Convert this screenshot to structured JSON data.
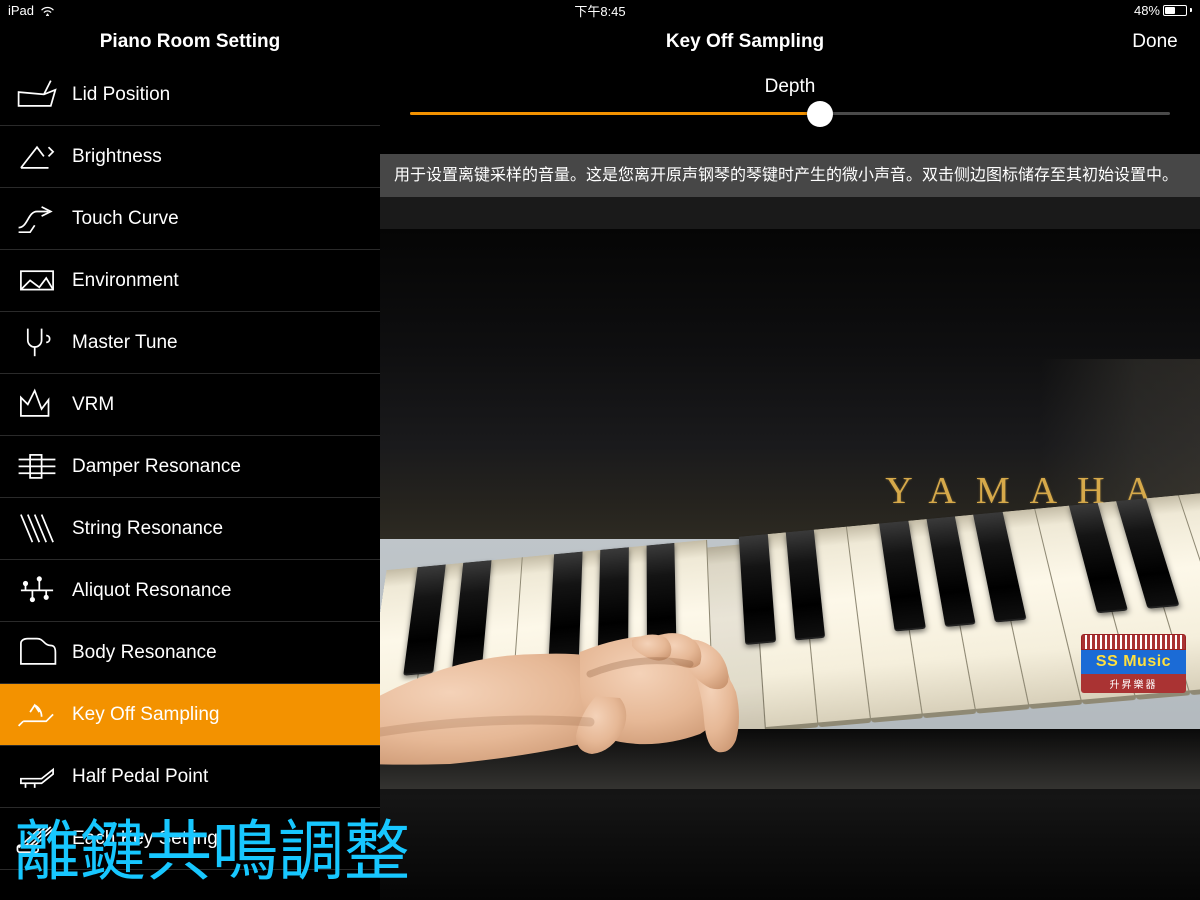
{
  "status": {
    "device": "iPad",
    "time": "下午8:45",
    "battery_pct": "48%",
    "battery_fill_pct": 48
  },
  "header": {
    "sidebar_title": "Piano Room Setting",
    "detail_title": "Key Off Sampling",
    "done_label": "Done"
  },
  "sidebar": {
    "items": [
      {
        "label": "Lid Position",
        "icon": "piano-lid-icon"
      },
      {
        "label": "Brightness",
        "icon": "brightness-icon"
      },
      {
        "label": "Touch Curve",
        "icon": "touch-curve-icon"
      },
      {
        "label": "Environment",
        "icon": "environment-icon"
      },
      {
        "label": "Master Tune",
        "icon": "tuning-fork-icon"
      },
      {
        "label": "VRM",
        "icon": "vrm-icon"
      },
      {
        "label": "Damper Resonance",
        "icon": "damper-icon"
      },
      {
        "label": "String Resonance",
        "icon": "strings-icon"
      },
      {
        "label": "Aliquot Resonance",
        "icon": "aliquot-icon"
      },
      {
        "label": "Body Resonance",
        "icon": "piano-body-icon"
      },
      {
        "label": "Key Off Sampling",
        "icon": "key-off-icon"
      },
      {
        "label": "Half Pedal Point",
        "icon": "pedal-icon"
      },
      {
        "label": "Each Key Setting",
        "icon": "keys-icon"
      }
    ],
    "selected_index": 10
  },
  "slider": {
    "label": "Depth",
    "value_pct": 54
  },
  "description": "用于设置离键采样的音量。这是您离开原声钢琴的琴键时产生的微小声音。双击侧边图标储存至其初始设置中。",
  "brand": "YAMAHA",
  "badge": {
    "title": "SS Music",
    "subtitle": "升昇樂器"
  },
  "caption": "離鍵共鳴調整"
}
